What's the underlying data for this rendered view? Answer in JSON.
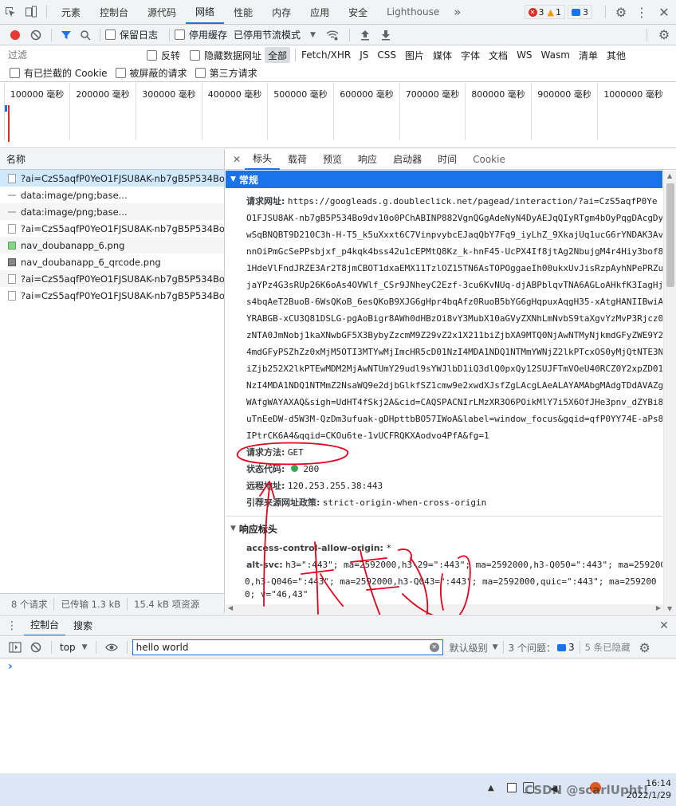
{
  "devtools": {
    "main_tabs": [
      "元素",
      "控制台",
      "源代码",
      "网络",
      "性能",
      "内存",
      "应用",
      "安全",
      "Lighthouse"
    ],
    "active_tab": "网络",
    "more_tabs": "»",
    "errors_count": "3",
    "warnings_count": "1",
    "messages_count": "3"
  },
  "network_toolbar": {
    "preserve_log": "保留日志",
    "disable_cache": "停用缓存",
    "throttling": "已停用节流模式"
  },
  "filter_bar": {
    "filter_placeholder": "过滤",
    "invert": "反转",
    "hide_data_urls": "隐藏数据网址",
    "types": [
      "全部",
      "Fetch/XHR",
      "JS",
      "CSS",
      "图片",
      "媒体",
      "字体",
      "文档",
      "WS",
      "Wasm",
      "清单",
      "其他"
    ],
    "blocked_cookies": "有已拦截的 Cookie",
    "blocked_requests": "被屏蔽的请求",
    "third_party": "第三方请求"
  },
  "timeline": {
    "ticks": [
      "100000 毫秒",
      "200000 毫秒",
      "300000 毫秒",
      "400000 毫秒",
      "500000 毫秒",
      "600000 毫秒",
      "700000 毫秒",
      "800000 毫秒",
      "900000 毫秒",
      "1000000 毫秒"
    ]
  },
  "request_list": {
    "header": "名称",
    "rows": [
      {
        "name": "?ai=CzS5aqfP0YeO1FJSU8AK-nb7gB5P534Bo...",
        "kind": "doc"
      },
      {
        "name": "data:image/png;base...",
        "kind": "dim"
      },
      {
        "name": "data:image/png;base...",
        "kind": "dim"
      },
      {
        "name": "?ai=CzS5aqfP0YeO1FJSU8AK-nb7gB5P534Bo...",
        "kind": "doc"
      },
      {
        "name": "nav_doubanapp_6.png",
        "kind": "img"
      },
      {
        "name": "nav_doubanapp_6_qrcode.png",
        "kind": "qr"
      },
      {
        "name": "?ai=CzS5aqfP0YeO1FJSU8AK-nb7gB5P534Bo...",
        "kind": "doc"
      },
      {
        "name": "?ai=CzS5aqfP0YeO1FJSU8AK-nb7gB5P534Bo...",
        "kind": "doc"
      }
    ],
    "status_requests": "8 个请求",
    "status_transferred": "已传输 1.3 kB",
    "status_resources": "15.4 kB 项资源"
  },
  "details": {
    "tabs": [
      "标头",
      "载荷",
      "预览",
      "响应",
      "启动器",
      "时间",
      "Cookie"
    ],
    "active_tab": "标头",
    "general_title": "常规",
    "request_url_label": "请求网址:",
    "request_url_lines": [
      "https://googleads.g.doubleclick.net/pagead/interaction/?ai=CzS5aqfP0Ye",
      "O1FJSU8AK-nb7gB5P534Bo9dv10o0PChABINP882VgnQGgAdeNyN4DyAEJqQIyRTgm4bOyPqgDAcgDy",
      "wSqBNQBT9D210C3h-H-T5_k5uXxxt6C7VinpvybcEJaqQbY7Fq9_iyLhZ_9XkajUq1ucG6rYNDAK3Av",
      "nnOiPmGcSePPsbjxf_p4kqk4bss42u1cEPMtQ8Kz_k-hnF45-UcPX4If8jtAg2NbujgM4r4Hiy3bof8",
      "1HdeVlFndJRZE3Ar2T8jmCBOT1dxaEMX11TzlOZ15TN6AsTOPOggaeIh00ukxUvJisRzpAyhNPePRZu",
      "jaYPz4G3sRUp26K6oAs4OVWlf_CSr9JNheyC2Ezf-3cu6KvNUq-djABPblqvTNA6AGLoAHkfK3IagHj",
      "s4bqAeT2BuoB-6WsQKoB_6esQKoB9XJG6gHpr4bqAfz0RuoB5bYG6gHqpuxAqgH35-xAtgHANIIBwiA",
      "YRABGB-xCU3Q81DSLG-pgAoBigr8AWh0dHBzOi8vY3MubX10aGVyZXNhLmNvbS9taXgvYzMvP3Rjcz0",
      "zNTA0JmNobj1kaXNwbGF5X3BybyZzcmM9Z29vZ2x1X211biZjbXA9MTQ0NjAwNTMyNjkmdGFyZWE9Y2",
      "4mdGFyPSZhZz0xMjM5OTI3MTYwMjImcHR5cD01NzI4MDA1NDQ1NTMmYWNjZ2lkPTcxOS0yMjQtNTE3N",
      "iZjb252X2lkPTEwMDM2MjAwNTUmY29udl9sYWJlbD1iQ3dlQ0pxQy12SUJFTmVOeU40RCZ0Y2xpZD01",
      "NzI4MDA1NDQ1NTMmZ2NsaWQ9e2djbGlkfSZ1cmw9e2xwdXJsfZgLAcgLAeALAYAMAbgMAdgTDdAVAZg",
      "WAfgWAYAXAQ&sigh=UdHT4fSkj2A&cid=CAQSPACNIrLMzXR3O6POikMlY7i5X6OfJHe3pnv_dZYBi8",
      "uTnEeDW-d5W3M-QzDm3ufuak-gDHpttbBO57IWoA&label=window_focus&gqid=qfP0YY74E-aPs8",
      "IPtrCK6A4&qqid=CKOu6te-1vUCFRQKXAodvo4PfA&fg=1"
    ],
    "method_label": "请求方法:",
    "method_value": "GET",
    "status_label": "状态代码:",
    "status_value": "200",
    "remote_label": "远程地址:",
    "remote_value": "120.253.255.38:443",
    "referrer_label": "引荐来源网址政策:",
    "referrer_value": "strict-origin-when-cross-origin",
    "response_headers_title": "响应标头",
    "acao_label": "access-control-allow-origin:",
    "acao_value": "*",
    "altsvc_label": "alt-svc:",
    "altsvc_lines": [
      "h3=\":443\"; ma=2592000,h3-29=\":443\"; ma=2592000,h3-Q050=\":443\"; ma=259200",
      "0,h3-Q046=\":443\"; ma=2592000,h3-Q043=\":443\"; ma=2592000,quic=\":443\"; ma=259200",
      "0; v=\"46,43\""
    ]
  },
  "drawer": {
    "tabs": [
      "控制台",
      "搜索"
    ],
    "active_tab": "控制台",
    "context": "top",
    "filter_value": "hello world",
    "levels": "默认级别",
    "issues_label": "3 个问题：",
    "issues_count": "3",
    "hidden_count": "5 条已隐藏",
    "prompt": "›"
  },
  "taskbar": {
    "time": "16:14",
    "date": "2022/1/29",
    "watermark": "CSDN @scarlUpht!"
  },
  "colors": {
    "accent": "#1a73e8",
    "record": "#e53935",
    "annotation": "#e3001b",
    "status_ok": "#34a853"
  }
}
